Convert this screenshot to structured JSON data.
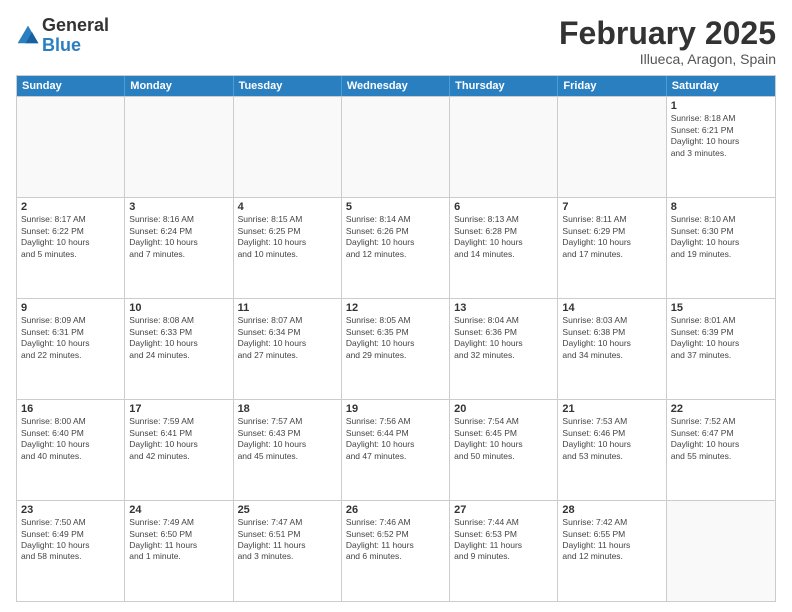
{
  "header": {
    "logo_general": "General",
    "logo_blue": "Blue",
    "month_title": "February 2025",
    "location": "Illueca, Aragon, Spain"
  },
  "days_of_week": [
    "Sunday",
    "Monday",
    "Tuesday",
    "Wednesday",
    "Thursday",
    "Friday",
    "Saturday"
  ],
  "rows": [
    [
      {
        "day": "",
        "info": ""
      },
      {
        "day": "",
        "info": ""
      },
      {
        "day": "",
        "info": ""
      },
      {
        "day": "",
        "info": ""
      },
      {
        "day": "",
        "info": ""
      },
      {
        "day": "",
        "info": ""
      },
      {
        "day": "1",
        "info": "Sunrise: 8:18 AM\nSunset: 6:21 PM\nDaylight: 10 hours\nand 3 minutes."
      }
    ],
    [
      {
        "day": "2",
        "info": "Sunrise: 8:17 AM\nSunset: 6:22 PM\nDaylight: 10 hours\nand 5 minutes."
      },
      {
        "day": "3",
        "info": "Sunrise: 8:16 AM\nSunset: 6:24 PM\nDaylight: 10 hours\nand 7 minutes."
      },
      {
        "day": "4",
        "info": "Sunrise: 8:15 AM\nSunset: 6:25 PM\nDaylight: 10 hours\nand 10 minutes."
      },
      {
        "day": "5",
        "info": "Sunrise: 8:14 AM\nSunset: 6:26 PM\nDaylight: 10 hours\nand 12 minutes."
      },
      {
        "day": "6",
        "info": "Sunrise: 8:13 AM\nSunset: 6:28 PM\nDaylight: 10 hours\nand 14 minutes."
      },
      {
        "day": "7",
        "info": "Sunrise: 8:11 AM\nSunset: 6:29 PM\nDaylight: 10 hours\nand 17 minutes."
      },
      {
        "day": "8",
        "info": "Sunrise: 8:10 AM\nSunset: 6:30 PM\nDaylight: 10 hours\nand 19 minutes."
      }
    ],
    [
      {
        "day": "9",
        "info": "Sunrise: 8:09 AM\nSunset: 6:31 PM\nDaylight: 10 hours\nand 22 minutes."
      },
      {
        "day": "10",
        "info": "Sunrise: 8:08 AM\nSunset: 6:33 PM\nDaylight: 10 hours\nand 24 minutes."
      },
      {
        "day": "11",
        "info": "Sunrise: 8:07 AM\nSunset: 6:34 PM\nDaylight: 10 hours\nand 27 minutes."
      },
      {
        "day": "12",
        "info": "Sunrise: 8:05 AM\nSunset: 6:35 PM\nDaylight: 10 hours\nand 29 minutes."
      },
      {
        "day": "13",
        "info": "Sunrise: 8:04 AM\nSunset: 6:36 PM\nDaylight: 10 hours\nand 32 minutes."
      },
      {
        "day": "14",
        "info": "Sunrise: 8:03 AM\nSunset: 6:38 PM\nDaylight: 10 hours\nand 34 minutes."
      },
      {
        "day": "15",
        "info": "Sunrise: 8:01 AM\nSunset: 6:39 PM\nDaylight: 10 hours\nand 37 minutes."
      }
    ],
    [
      {
        "day": "16",
        "info": "Sunrise: 8:00 AM\nSunset: 6:40 PM\nDaylight: 10 hours\nand 40 minutes."
      },
      {
        "day": "17",
        "info": "Sunrise: 7:59 AM\nSunset: 6:41 PM\nDaylight: 10 hours\nand 42 minutes."
      },
      {
        "day": "18",
        "info": "Sunrise: 7:57 AM\nSunset: 6:43 PM\nDaylight: 10 hours\nand 45 minutes."
      },
      {
        "day": "19",
        "info": "Sunrise: 7:56 AM\nSunset: 6:44 PM\nDaylight: 10 hours\nand 47 minutes."
      },
      {
        "day": "20",
        "info": "Sunrise: 7:54 AM\nSunset: 6:45 PM\nDaylight: 10 hours\nand 50 minutes."
      },
      {
        "day": "21",
        "info": "Sunrise: 7:53 AM\nSunset: 6:46 PM\nDaylight: 10 hours\nand 53 minutes."
      },
      {
        "day": "22",
        "info": "Sunrise: 7:52 AM\nSunset: 6:47 PM\nDaylight: 10 hours\nand 55 minutes."
      }
    ],
    [
      {
        "day": "23",
        "info": "Sunrise: 7:50 AM\nSunset: 6:49 PM\nDaylight: 10 hours\nand 58 minutes."
      },
      {
        "day": "24",
        "info": "Sunrise: 7:49 AM\nSunset: 6:50 PM\nDaylight: 11 hours\nand 1 minute."
      },
      {
        "day": "25",
        "info": "Sunrise: 7:47 AM\nSunset: 6:51 PM\nDaylight: 11 hours\nand 3 minutes."
      },
      {
        "day": "26",
        "info": "Sunrise: 7:46 AM\nSunset: 6:52 PM\nDaylight: 11 hours\nand 6 minutes."
      },
      {
        "day": "27",
        "info": "Sunrise: 7:44 AM\nSunset: 6:53 PM\nDaylight: 11 hours\nand 9 minutes."
      },
      {
        "day": "28",
        "info": "Sunrise: 7:42 AM\nSunset: 6:55 PM\nDaylight: 11 hours\nand 12 minutes."
      },
      {
        "day": "",
        "info": ""
      }
    ]
  ]
}
